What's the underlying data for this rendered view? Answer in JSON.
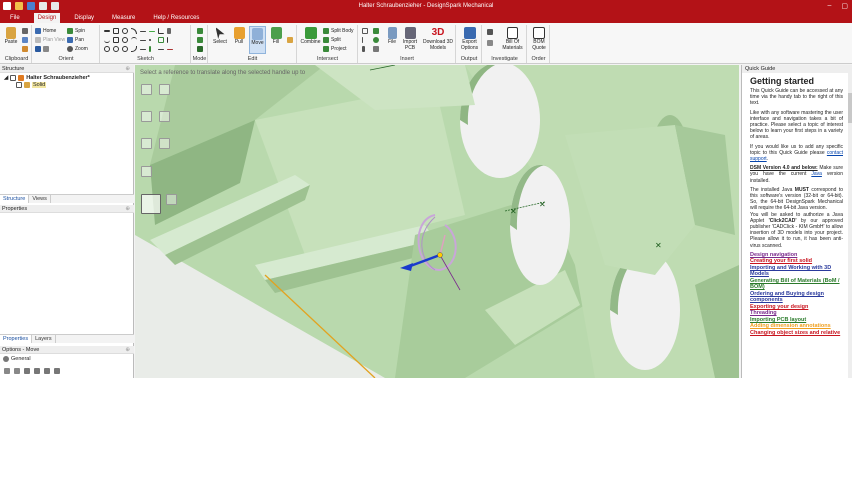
{
  "window": {
    "title": "Halter Schraubenzieher - DesignSpark Mechanical",
    "controls": [
      "–",
      "▢",
      "✕"
    ]
  },
  "menu": {
    "tabs": [
      "File",
      "Design",
      "Display",
      "Measure",
      "Help / Resources"
    ],
    "active": "Design"
  },
  "ribbon": {
    "groups": {
      "clipboard": "Clipboard",
      "orient": "Orient",
      "sketch": "Sketch",
      "mode": "Mode",
      "edit": "Edit",
      "intersect": "Intersect",
      "insert": "Insert",
      "output": "Output",
      "investigate": "Investigate",
      "order": "Order"
    },
    "clipboard": {
      "paste": "Paste"
    },
    "orient": {
      "home": "Home",
      "spin": "Spin",
      "plan_view": "Plan View",
      "pan": "Pan",
      "zoom": "Zoom"
    },
    "edit": {
      "select": "Select",
      "pull": "Pull",
      "move": "Move",
      "fill": "Fill"
    },
    "intersect": {
      "combine": "Combine",
      "split_body": "Split Body",
      "split": "Split",
      "project": "Project"
    },
    "insert": {
      "file": "File",
      "import_pcb": "Import PCB",
      "download_3d": "Download 3D Models",
      "badge_3d": "3D"
    },
    "output": {
      "export": "Export Options"
    },
    "investigate": {
      "bom": "Bill Of Materials"
    },
    "order": {
      "bom_quote": "BOM Quote"
    }
  },
  "structure": {
    "header": "Structure",
    "root": "Halter Schraubenzieher*",
    "child": "Solid",
    "tabs": [
      "Structure",
      "Views"
    ]
  },
  "properties": {
    "header": "Properties",
    "tabs": [
      "Properties",
      "Layers"
    ]
  },
  "options": {
    "header": "Options - Move",
    "general": "General"
  },
  "viewport": {
    "hint": "Select a reference to translate along the selected handle up to"
  },
  "quick_guide": {
    "header": "Quick Guide",
    "title": "Getting started",
    "p1": "This Quick Guide can be accessed at any time via the handy tab to the right of this text.",
    "p2": "Like with any software mastering the user interface and navigation takes a bit of practice. Please select a topic of interest below to learn your first steps in a variety of areas.",
    "p3a": "If you would like us to add any specific topic to this Quick Guide please ",
    "p3link": "contact support",
    "p3b": ".",
    "p4head": "DSM Version 4.0 and below:",
    "p4a": " Make sure you have the current ",
    "p4link": "Java",
    "p4b": " version installed.",
    "p5a": "The installed Java ",
    "p5must": "MUST",
    "p5b": " correspond to this software's version (32-bit or 64-bit). So, the 64-bit DesignSpark Mechanical will require the 64-bit Java version.",
    "p6a": "You will be asked to authorize a Java Applet ",
    "p6bold": "'Click2CAD'",
    "p6b": " by our approved publisher 'CADClick - KIM GmbH' to allow insertion of 3D models into your project. Please allow it to run, it has been anti-virus scanned.",
    "topics": [
      {
        "label": "Design navigation",
        "color": "#7a2a8c"
      },
      {
        "label": "Creating your first solid",
        "color": "#c8141e"
      },
      {
        "label": "Importing and Working with 3D Models",
        "color": "#2a3a9c"
      },
      {
        "label": "Generating Bill of Materials (BoM / BOM)",
        "color": "#2a7a2a"
      },
      {
        "label": "Ordering and Buying design components",
        "color": "#2a3a9c"
      },
      {
        "label": "Exporting your design",
        "color": "#c8141e"
      },
      {
        "label": "Threading",
        "color": "#7a2a8c"
      },
      {
        "label": "Importing PCB layout",
        "color": "#2a7a2a"
      },
      {
        "label": "Adding dimension annotations",
        "color": "#f0a020"
      },
      {
        "label": "Changing object sizes and relative",
        "color": "#c8141e"
      }
    ]
  }
}
